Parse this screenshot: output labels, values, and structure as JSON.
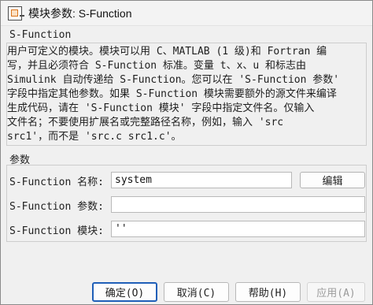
{
  "window": {
    "title": "模块参数: S-Function"
  },
  "description_section": {
    "label": "S-Function",
    "text": "用户可定义的模块。模块可以用 C、MATLAB (1 级)和 Fortran 编\n写，并且必须符合 S-Function 标准。变量 t、x、u 和标志由\nSimulink 自动传递给 S-Function。您可以在 'S-Function 参数'\n字段中指定其他参数。如果 S-Function 模块需要额外的源文件来编译\n生成代码，请在 'S-Function 模块' 字段中指定文件名。仅输入\n文件名；不要使用扩展名或完整路径名称，例如，输入 'src\nsrc1'，而不是 'src.c src1.c'。"
  },
  "params_section": {
    "label": "参数",
    "name_field": {
      "label": "S-Function 名称:",
      "value": "system"
    },
    "params_field": {
      "label": "S-Function 参数:",
      "value": ""
    },
    "modules_field": {
      "label": "S-Function 模块:",
      "value": "''"
    },
    "edit_label": "编辑"
  },
  "buttons": {
    "ok": "确定(O)",
    "cancel": "取消(C)",
    "help": "帮助(H)",
    "apply": "应用(A)"
  },
  "colors": {
    "primary_border": "#1f5fb8",
    "background": "#f0f0f0"
  }
}
